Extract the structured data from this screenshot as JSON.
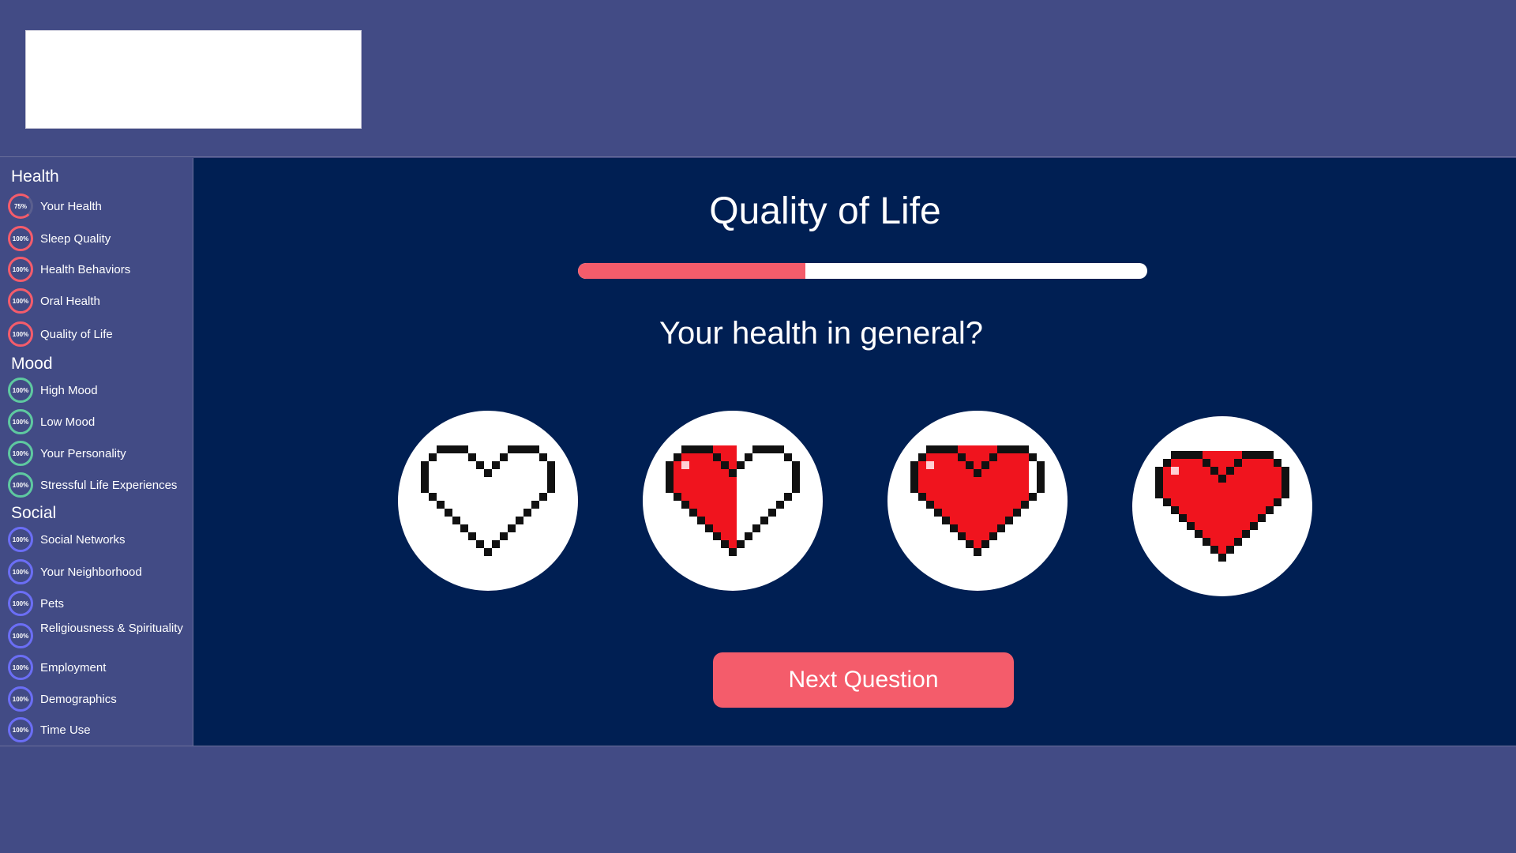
{
  "sidebar": {
    "groups": [
      {
        "title": "Health",
        "color": "#f45c6b",
        "items": [
          {
            "label": "Your Health",
            "percent": "75%",
            "progress": 0.75
          },
          {
            "label": "Sleep Quality",
            "percent": "100%",
            "progress": 1.0
          },
          {
            "label": "Health Behaviors",
            "percent": "100%",
            "progress": 1.0
          },
          {
            "label": "Oral Health",
            "percent": "100%",
            "progress": 1.0
          },
          {
            "label": "Quality of Life",
            "percent": "100%",
            "progress": 1.0
          }
        ]
      },
      {
        "title": "Mood",
        "color": "#5ec9a0",
        "items": [
          {
            "label": "High Mood",
            "percent": "100%",
            "progress": 1.0
          },
          {
            "label": "Low Mood",
            "percent": "100%",
            "progress": 1.0
          },
          {
            "label": "Your Personality",
            "percent": "100%",
            "progress": 1.0
          },
          {
            "label": "Stressful Life Experiences",
            "percent": "100%",
            "progress": 1.0
          }
        ]
      },
      {
        "title": "Social",
        "color": "#6b6ef5",
        "items": [
          {
            "label": "Social Networks",
            "percent": "100%",
            "progress": 1.0
          },
          {
            "label": "Your Neighborhood",
            "percent": "100%",
            "progress": 1.0
          },
          {
            "label": "Pets",
            "percent": "100%",
            "progress": 1.0
          },
          {
            "label": "Religiousness & Spirituality",
            "percent": "100%",
            "progress": 1.0
          },
          {
            "label": "Employment",
            "percent": "100%",
            "progress": 1.0
          },
          {
            "label": "Demographics",
            "percent": "100%",
            "progress": 1.0
          },
          {
            "label": "Time Use",
            "percent": "100%",
            "progress": 1.0
          }
        ]
      }
    ]
  },
  "main": {
    "title": "Quality of Life",
    "progress": 0.4,
    "progress_color": "#f45c6b",
    "question": "Your health in general?",
    "options": [
      {
        "icon": "empty-heart-icon",
        "fill": 0
      },
      {
        "icon": "half-heart-icon",
        "fill": 0.5
      },
      {
        "icon": "mostly-full-heart-icon",
        "fill": 0.85
      },
      {
        "icon": "full-heart-icon",
        "fill": 1
      }
    ],
    "next_label": "Next Question"
  }
}
